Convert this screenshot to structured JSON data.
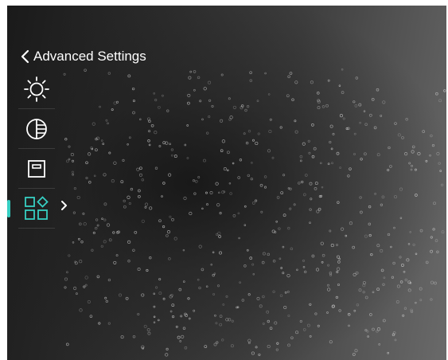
{
  "header": {
    "title": "Advanced Settings",
    "back_icon": "chevron-left-icon"
  },
  "menu": {
    "items": [
      {
        "icon": "brightness-icon",
        "active": false
      },
      {
        "icon": "contrast-icon",
        "active": false
      },
      {
        "icon": "frame-icon",
        "active": false
      },
      {
        "icon": "function-settings-icon",
        "active": true
      }
    ],
    "submenu_indicator": "chevron-right-icon"
  },
  "colors": {
    "accent": "#36cfc3",
    "icon": "#ffffff",
    "text": "#ffffff"
  }
}
